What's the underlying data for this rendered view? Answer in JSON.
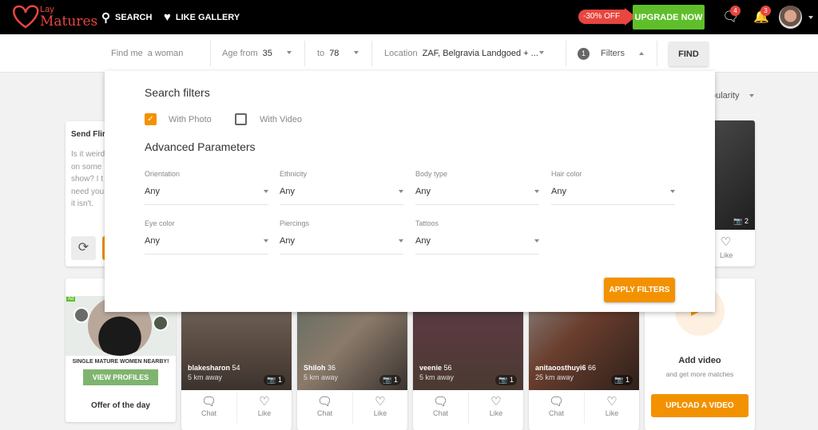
{
  "header": {
    "logo_line1": "Lay",
    "logo_line2": "Matures",
    "nav": [
      {
        "icon": "search-icon",
        "label": "SEARCH"
      },
      {
        "icon": "heart-icon",
        "label": "LIKE GALLERY"
      }
    ],
    "promo": "-30% OFF",
    "upgrade_label": "UPGRADE NOW",
    "messages_badge": "4",
    "notifications_badge": "3",
    "colors": {
      "accent": "#f39200",
      "upgrade": "#5fbf2a",
      "badge": "#e8463f"
    }
  },
  "searchbar": {
    "find_me_label": "Find me",
    "find_me_value": "a woman",
    "age_from_label": "Age from",
    "age_from_value": "35",
    "age_to_label": "to",
    "age_to_value": "78",
    "location_label": "Location",
    "location_value": "ZAF, Belgravia Landgoed + ...",
    "filters_count": "1",
    "filters_label": "Filters",
    "find_label": "FIND"
  },
  "sort": {
    "value_partial": "pularity"
  },
  "filters_panel": {
    "title": "Search filters",
    "checkboxes": [
      {
        "label": "With Photo",
        "checked": true
      },
      {
        "label": "With Video",
        "checked": false
      }
    ],
    "advanced_title": "Advanced Parameters",
    "fields": [
      {
        "label": "Orientation",
        "value": "Any"
      },
      {
        "label": "Ethnicity",
        "value": "Any"
      },
      {
        "label": "Body type",
        "value": "Any"
      },
      {
        "label": "Hair color",
        "value": "Any"
      },
      {
        "label": "Eye color",
        "value": "Any"
      },
      {
        "label": "Piercings",
        "value": "Any"
      },
      {
        "label": "Tattoos",
        "value": "Any"
      }
    ],
    "apply_label": "APPLY FILTERS"
  },
  "flirt_card": {
    "title": "Send Flir",
    "lines": [
      "Is it weird",
      "on some",
      "show? I t",
      "need you",
      "it isn't."
    ]
  },
  "top_right_card": {
    "photo_count": "2",
    "like_label": "Like"
  },
  "ad_card": {
    "ad_badge": "Ad",
    "headline": "SINGLE MATURE WOMEN NEARBY!",
    "button": "VIEW PROFILES",
    "footer": "Offer of the day"
  },
  "profiles": [
    {
      "name": "blakesharon",
      "age": "54",
      "distance": "5 km away",
      "photos": "1",
      "chat": "Chat",
      "like": "Like"
    },
    {
      "name": "Shiloh",
      "age": "36",
      "distance": "5 km away",
      "photos": "1",
      "chat": "Chat",
      "like": "Like"
    },
    {
      "name": "veenie",
      "age": "56",
      "distance": "5 km away",
      "photos": "1",
      "chat": "Chat",
      "like": "Like"
    },
    {
      "name": "anitaoosthuyi6",
      "age": "66",
      "distance": "25 km away",
      "photos": "1",
      "chat": "Chat",
      "like": "Like"
    }
  ],
  "video_card": {
    "title": "Add video",
    "subtitle": "and get more matches",
    "button": "UPLOAD A VIDEO"
  }
}
